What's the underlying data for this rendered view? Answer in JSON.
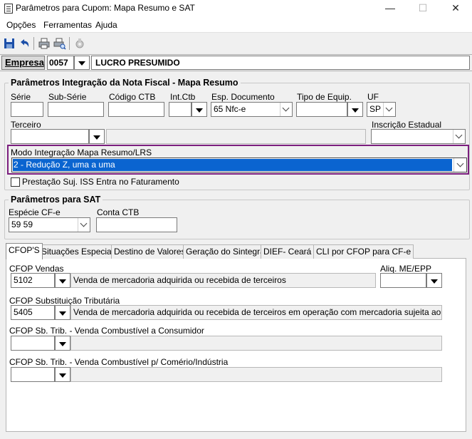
{
  "window": {
    "title": "Parâmetros para Cupom: Mapa Resumo e SAT",
    "controls": {
      "minimize": "—",
      "maximize": "☐",
      "close": "✕"
    }
  },
  "menu": {
    "items": [
      "Opções",
      "Ferramentas",
      "Ajuda"
    ]
  },
  "toolbar": {
    "buttons": [
      {
        "name": "save-icon"
      },
      {
        "name": "undo-icon"
      },
      {
        "name": "print-icon"
      },
      {
        "name": "print-preview-icon"
      },
      {
        "name": "settings-gear-icon"
      }
    ]
  },
  "empresa": {
    "label": "Empresa",
    "code": "0057",
    "name": "LUCRO PRESUMIDO"
  },
  "mapa_resumo": {
    "title": "Parâmetros Integração da Nota Fiscal - Mapa Resumo",
    "serie_label": "Série",
    "serie_value": "",
    "subserie_label": "Sub-Série",
    "subserie_value": "",
    "codigo_ctb_label": "Código CTB",
    "codigo_ctb_value": "",
    "int_ctb_label": "Int.Ctb",
    "int_ctb_value": "",
    "esp_doc_label": "Esp. Documento",
    "esp_doc_value": "65 Nfc-e",
    "tipo_equip_label": "Tipo de Equip.",
    "tipo_equip_value": "",
    "uf_label": "UF",
    "uf_value": "SP",
    "terceiro_label": "Terceiro",
    "terceiro_value": "",
    "terceiro_desc": "",
    "inscricao_label": "Inscrição Estadual",
    "inscricao_value": "",
    "modo_label": "Modo Integração Mapa Resumo/LRS",
    "modo_value": "2 - Redução Z, uma a uma",
    "prestacao_label": "Prestação Suj. ISS Entra no Faturamento",
    "prestacao_checked": false
  },
  "sat": {
    "title": "Parâmetros para SAT",
    "especie_label": "Espécie CF-e",
    "especie_value": "59 59",
    "conta_ctb_label": "Conta CTB",
    "conta_ctb_value": ""
  },
  "tabs": [
    {
      "label": "CFOP'S",
      "active": true
    },
    {
      "label": "Situações Especiais",
      "active": false
    },
    {
      "label": "Destino de Valores",
      "active": false
    },
    {
      "label": "Geração do Sintegra",
      "active": false
    },
    {
      "label": "DIEF- Ceará",
      "active": false
    },
    {
      "label": "CLI por CFOP para CF-e",
      "active": false
    }
  ],
  "cfops": {
    "vendas_label": "CFOP Vendas",
    "vendas_code": "5102",
    "vendas_desc": "Venda de mercadoria adquirida ou recebida de terceiros",
    "aliq_label": "Aliq. ME/EPP",
    "aliq_value": "",
    "subst_label": "CFOP Substituição Tributária",
    "subst_code": "5405",
    "subst_desc": "Venda de mercadoria adquirida ou recebida de terceiros em operação com mercadoria sujeita ao regime de s",
    "comb_consumidor_label": "CFOP Sb. Trib. - Venda Combustível a Consumidor",
    "comb_consumidor_code": "",
    "comb_consumidor_desc": "",
    "comb_comercio_label": "CFOP Sb. Trib. - Venda Combustível p/ Comério/Indústria",
    "comb_comercio_code": "",
    "comb_comercio_desc": ""
  }
}
